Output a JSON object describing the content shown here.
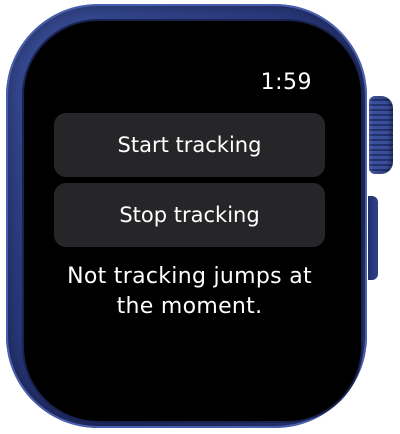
{
  "status_bar": {
    "time": "1:59"
  },
  "actions": {
    "start_label": "Start tracking",
    "stop_label": "Stop tracking"
  },
  "status": {
    "message": "Not tracking jumps at the moment."
  },
  "device": {
    "case_color": "#2a3a7e",
    "screen_color": "#000000",
    "button_color": "#262629"
  }
}
